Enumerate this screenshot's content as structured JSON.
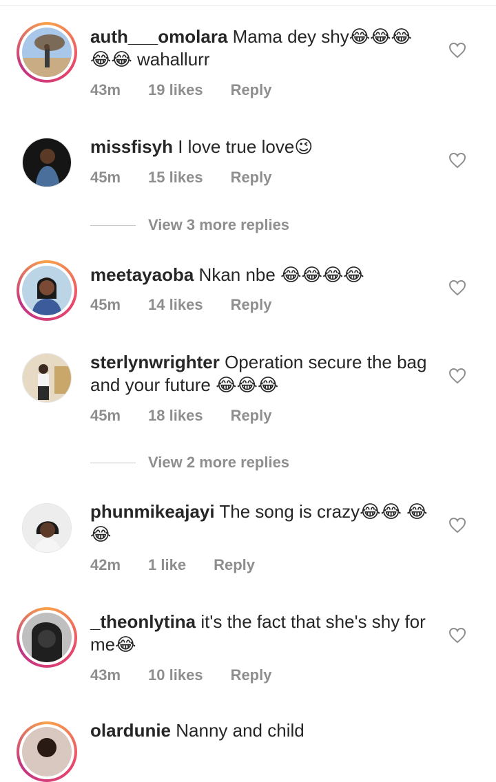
{
  "comments": [
    {
      "username": "auth___omolara",
      "text": "Mama dey shy😂😂😂 😂😂 wahallurr",
      "time": "43m",
      "likes": "19 likes",
      "reply": "Reply",
      "story": true
    },
    {
      "username": "missfisyh",
      "text": "I love true love😉",
      "time": "45m",
      "likes": "15 likes",
      "reply": "Reply",
      "story": false
    },
    {
      "username": "meetayaoba",
      "text": "Nkan nbe 😂😂😂😂",
      "time": "45m",
      "likes": "14 likes",
      "reply": "Reply",
      "story": true
    },
    {
      "username": "sterlynwrighter",
      "text": "Operation secure the bag and your future 😂😂😂",
      "time": "45m",
      "likes": "18 likes",
      "reply": "Reply",
      "story": false
    },
    {
      "username": "phunmikeajayi",
      "text": "The song is crazy😂😂 😂😂",
      "time": "42m",
      "likes": "1 like",
      "reply": "Reply",
      "story": false
    },
    {
      "username": "_theonlytina",
      "text": "it's the fact that she's shy for me😂",
      "time": "43m",
      "likes": "10 likes",
      "reply": "Reply",
      "story": true
    },
    {
      "username": "olardunie",
      "text": "Nanny and child"
    }
  ],
  "view_replies": [
    "View 3 more replies",
    "View 2 more replies"
  ],
  "icons": {
    "like": "heart-outline-icon"
  },
  "colors": {
    "text": "#262626",
    "muted": "#8e8e8e",
    "story_ring": "#e8456b"
  }
}
